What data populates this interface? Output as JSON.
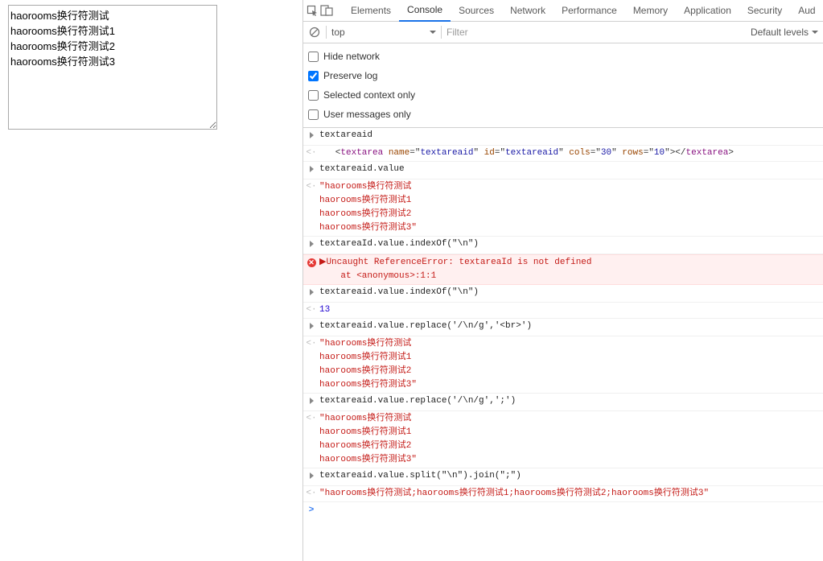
{
  "textarea": {
    "value": "haorooms换行符测试\nhaorooms换行符测试1\nhaorooms换行符测试2\nhaorooms换行符测试3"
  },
  "tabs": {
    "items": [
      "Elements",
      "Console",
      "Sources",
      "Network",
      "Performance",
      "Memory",
      "Application",
      "Security",
      "Aud"
    ],
    "active": "Console"
  },
  "filterbar": {
    "context": "top",
    "filter_placeholder": "Filter",
    "levels": "Default levels"
  },
  "options": {
    "hide_network": {
      "label": "Hide network",
      "checked": false
    },
    "preserve_log": {
      "label": "Preserve log",
      "checked": true
    },
    "selected_context": {
      "label": "Selected context only",
      "checked": false
    },
    "user_messages": {
      "label": "User messages only",
      "checked": false
    }
  },
  "console": {
    "rows": [
      {
        "kind": "in",
        "text": "textareaid"
      },
      {
        "kind": "out_html",
        "textarea_tag": "textarea",
        "attrs": {
          "name": "textareaid",
          "id": "textareaid",
          "cols": "30",
          "rows": "10"
        }
      },
      {
        "kind": "in",
        "text": "textareaid.value"
      },
      {
        "kind": "out_str_multi",
        "lines": [
          "\"haorooms换行符测试",
          "haorooms换行符测试1",
          "haorooms换行符测试2",
          "haorooms换行符测试3\""
        ]
      },
      {
        "kind": "in",
        "text": "textareaId.value.indexOf(\"\\n\")"
      },
      {
        "kind": "error",
        "lines": [
          "Uncaught ReferenceError: textareaId is not defined",
          "    at <anonymous>:1:1"
        ]
      },
      {
        "kind": "in",
        "text": "textareaid.value.indexOf(\"\\n\")"
      },
      {
        "kind": "out_num",
        "text": "13"
      },
      {
        "kind": "in",
        "text": "textareaid.value.replace('/\\n/g','<br>')"
      },
      {
        "kind": "out_str_multi",
        "lines": [
          "\"haorooms换行符测试",
          "haorooms换行符测试1",
          "haorooms换行符测试2",
          "haorooms换行符测试3\""
        ]
      },
      {
        "kind": "in",
        "text": "textareaid.value.replace('/\\n/g',';')"
      },
      {
        "kind": "out_str_multi",
        "lines": [
          "\"haorooms换行符测试",
          "haorooms换行符测试1",
          "haorooms换行符测试2",
          "haorooms换行符测试3\""
        ]
      },
      {
        "kind": "in",
        "text": "textareaid.value.split(\"\\n\").join(\";\")"
      },
      {
        "kind": "out_str",
        "text": "\"haorooms换行符测试;haorooms换行符测试1;haorooms换行符测试2;haorooms换行符测试3\""
      }
    ],
    "prompt": ">"
  }
}
